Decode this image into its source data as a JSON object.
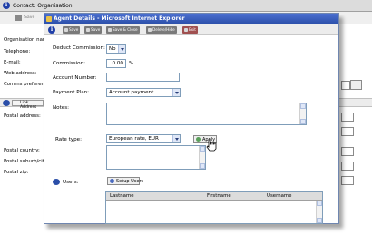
{
  "background": {
    "title": "Contact: Organisation",
    "toolbar_first_label": "Save",
    "labels": {
      "org_name": "Organisation name",
      "telephone": "Telephone:",
      "email": "E-mail:",
      "web": "Web address:",
      "comms": "Comms preference",
      "postal_address": "Postal address:",
      "postal_country": "Postal country:",
      "postal_suburb": "Postal suburb/city",
      "postal_zip": "Postal zip:"
    },
    "link_address_label": "Link Address"
  },
  "dialog": {
    "title": "Agent Details - Microsoft Internet Explorer",
    "toolbar": [
      "Save",
      "Save",
      "Save & Close",
      "Delete/Hide",
      "Exit"
    ],
    "fields": {
      "deduct_commission_label": "Deduct Commission:",
      "deduct_commission_value": "No",
      "commission_label": "Commission:",
      "commission_value": "0.00",
      "commission_unit": "%",
      "account_number_label": "Account Number:",
      "account_number_value": "",
      "payment_plan_label": "Payment Plan:",
      "payment_plan_value": "Account payment",
      "notes_label": "Notes:",
      "rate_type_label": "Rate type:",
      "rate_type_value": "European rate, EUR",
      "apply_label": "Apply",
      "users_label": "Users:",
      "setup_users_label": "Setup Users"
    },
    "users_table": {
      "columns": [
        "Lastname",
        "Firstname",
        "Username"
      ],
      "rows": []
    }
  }
}
